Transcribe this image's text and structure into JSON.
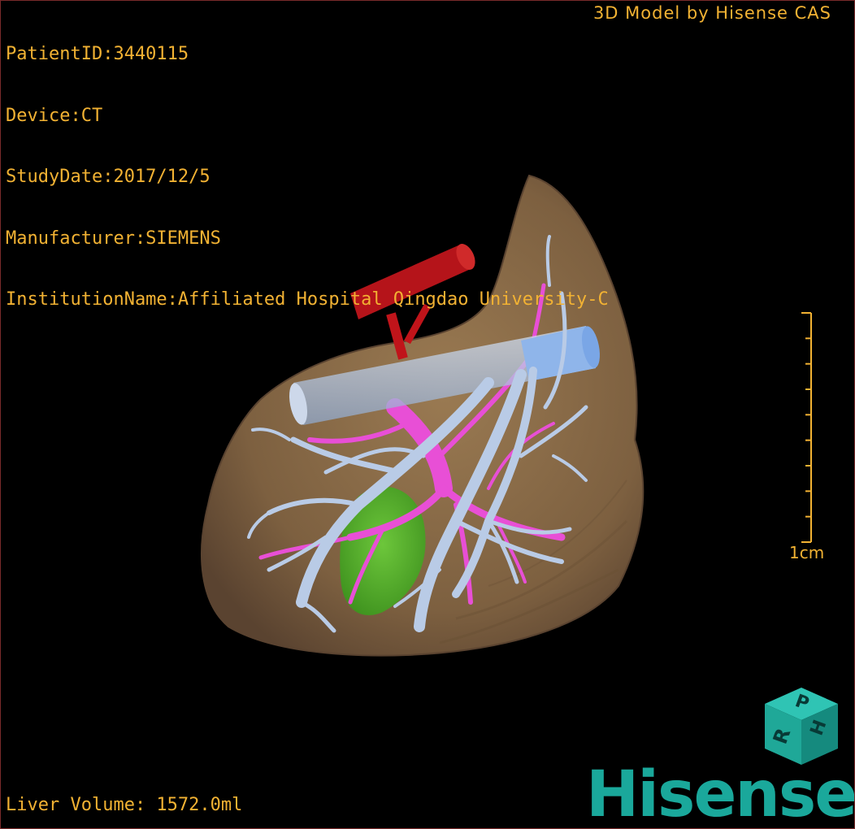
{
  "overlay": {
    "info_lines": [
      "PatientID:3440115",
      "Device:CT",
      "StudyDate:2017/12/5",
      "Manufacturer:SIEMENS",
      "InstitutionName:Affiliated Hospital Qingdao University-C"
    ],
    "credit": "3D Model by Hisense CAS",
    "volume": "Liver Volume: 1572.0ml",
    "scale_label": "1cm",
    "scale_ticks": 10
  },
  "orientation_cube": {
    "letters": [
      "P",
      "R",
      "H"
    ]
  },
  "brand": {
    "logo_text": "Hisense",
    "color": "#1aa89b"
  },
  "colors": {
    "overlay_text": "#f2b233",
    "liver": "#8a6a45",
    "artery": "#c0141a",
    "portal_vein": "#e84fd6",
    "hepatic_vein": "#b9cbe6",
    "ivc": "#a9c2ea",
    "gallbladder": "#4fbf2a"
  }
}
